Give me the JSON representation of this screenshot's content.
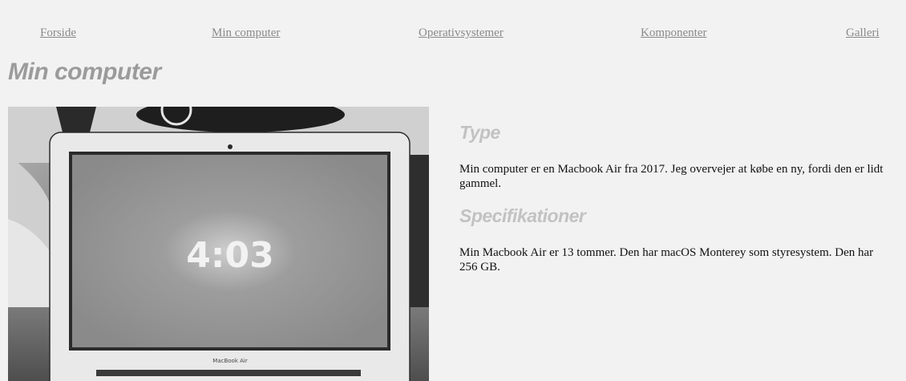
{
  "nav": {
    "items": [
      {
        "label": "Forside"
      },
      {
        "label": "Min computer"
      },
      {
        "label": "Operativsystemer"
      },
      {
        "label": "Komponenter"
      },
      {
        "label": "Galleri"
      }
    ]
  },
  "page": {
    "title": "Min computer"
  },
  "photo": {
    "screen_time": "4:03",
    "brand_text": "MacBook Air"
  },
  "sections": [
    {
      "heading": "Type",
      "text": "Min computer er en Macbook Air fra 2017. Jeg overvejer at købe en ny, fordi den er lidt gammel."
    },
    {
      "heading": "Specifikationer",
      "text": "Min Macbook Air er 13 tommer. Den har macOS Monterey som styresystem. Den har 256 GB."
    }
  ],
  "colors": {
    "background": "#f2f2f2",
    "nav_link": "#8a8a8a",
    "title": "#9b9b9b",
    "section_heading": "#c2c2c2",
    "body_text": "#111111"
  }
}
